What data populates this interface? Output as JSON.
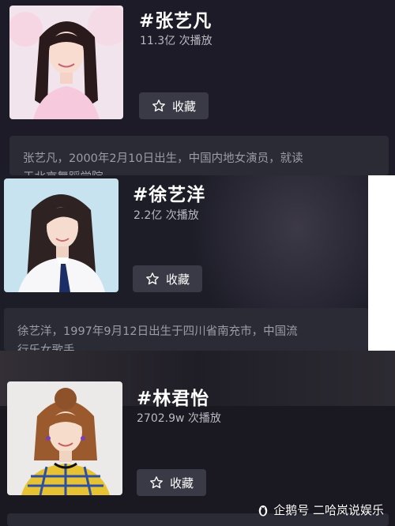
{
  "cards": [
    {
      "title": "#张艺凡",
      "plays": "11.3亿 次播放",
      "fav_label": "收藏",
      "desc_line1": "张艺凡，2000年2月10日出生，中国内地女演员，就读",
      "desc_line2": "于北京舞蹈学院"
    },
    {
      "title": "#徐艺洋",
      "plays": "2.2亿 次播放",
      "fav_label": "收藏",
      "desc_line1": "徐艺洋，1997年9月12日出生于四川省南充市，中国流",
      "desc_line2": "行乐女歌手"
    },
    {
      "title": "#林君怡",
      "plays": "2702.9w 次播放",
      "fav_label": "收藏",
      "desc_line1": "",
      "desc_line2": ""
    }
  ],
  "watermark": "企鹅号 二哈岚说娱乐",
  "icons": [
    "star-icon",
    "penguin-icon"
  ]
}
